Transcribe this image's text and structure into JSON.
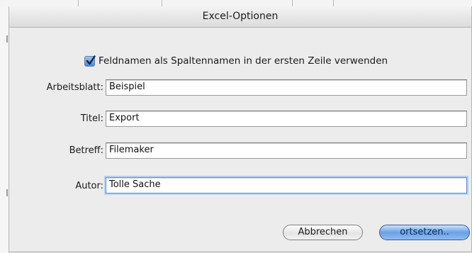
{
  "dialog": {
    "title": "Excel-Optionen",
    "checkbox": {
      "label": "Feldnamen als Spaltennamen in der ersten Zeile verwenden",
      "checked": true
    },
    "fields": {
      "worksheet": {
        "label": "Arbeitsblatt:",
        "value": "Beispiel"
      },
      "title": {
        "label": "Titel:",
        "value": "Export"
      },
      "subject": {
        "label": "Betreff:",
        "value": "Filemaker"
      },
      "author": {
        "label": "Autor:",
        "value": "Tolle Sache"
      }
    },
    "buttons": {
      "cancel": "Abbrechen",
      "continue": "ortsetzen.."
    }
  },
  "colors": {
    "accent": "#4d86d6",
    "background": "#ececec"
  }
}
